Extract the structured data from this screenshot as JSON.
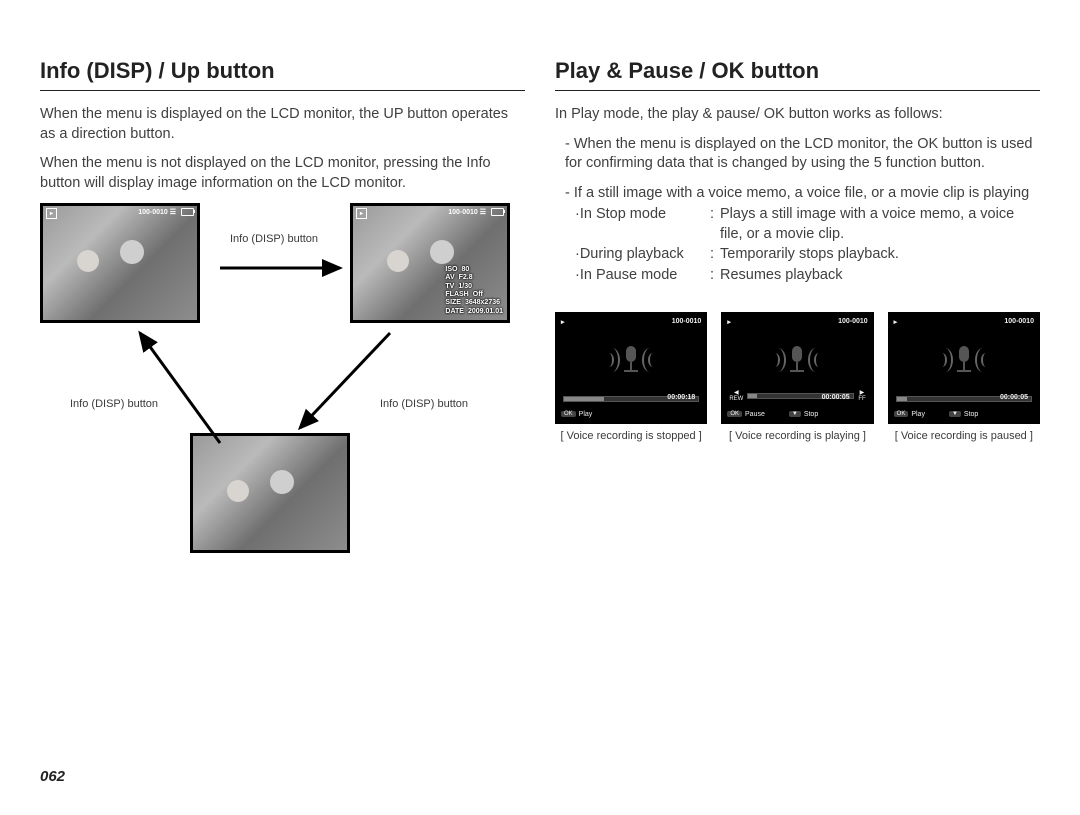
{
  "page_number": "062",
  "left": {
    "heading": "Info (DISP) / Up button",
    "para1": "When the menu is displayed on the LCD monitor, the UP button operates as a direction button.",
    "para2": "When the menu is not displayed on the LCD monitor, pressing the Info button will display image information on the LCD monitor.",
    "arrow_label": "Info (DISP) button",
    "lcd": {
      "counter": "100-0010",
      "details": {
        "iso_k": "ISO",
        "iso_v": "80",
        "av_k": "AV",
        "av_v": "F2.8",
        "tv_k": "TV",
        "tv_v": "1/30",
        "flash_k": "FLASH",
        "flash_v": "Off",
        "size_k": "SIZE",
        "size_v": "3648x2736",
        "date_k": "DATE",
        "date_v": "2009.01.01"
      }
    }
  },
  "right": {
    "heading": "Play & Pause / OK button",
    "intro": "In Play mode, the play & pause/ OK button works as follows:",
    "bul1": "- When the menu is displayed on the LCD monitor, the OK button is used for confirming data that is changed by using the 5 function button.",
    "bul2_lead": "- If a still image with a voice memo, a voice file, or a movie clip is playing",
    "modes": [
      {
        "k": "·In Stop mode",
        "v": "Plays a still image with a voice memo, a voice file, or a movie clip."
      },
      {
        "k": "·During playback",
        "v": "Temporarily stops playback."
      },
      {
        "k": "·In Pause mode",
        "v": "Resumes playback"
      }
    ],
    "lcds": [
      {
        "counter": "100-0010",
        "timer": "00:00:18",
        "foot": [
          {
            "b": "OK",
            "t": "Play"
          }
        ],
        "fill": 30,
        "rewff": false,
        "caption": "[ Voice recording is stopped ]"
      },
      {
        "counter": "100-0010",
        "timer": "00:00:05",
        "foot": [
          {
            "b": "OK",
            "t": "Pause"
          },
          {
            "b": "▼",
            "t": "Stop"
          }
        ],
        "fill": 8,
        "rewff": true,
        "caption": "[ Voice recording is playing ]"
      },
      {
        "counter": "100-0010",
        "timer": "00:00:05",
        "foot": [
          {
            "b": "OK",
            "t": "Play"
          },
          {
            "b": "▼",
            "t": "Stop"
          }
        ],
        "fill": 8,
        "rewff": false,
        "caption": "[ Voice recording is paused ]"
      }
    ],
    "rew": "REW",
    "ff": "FF"
  }
}
